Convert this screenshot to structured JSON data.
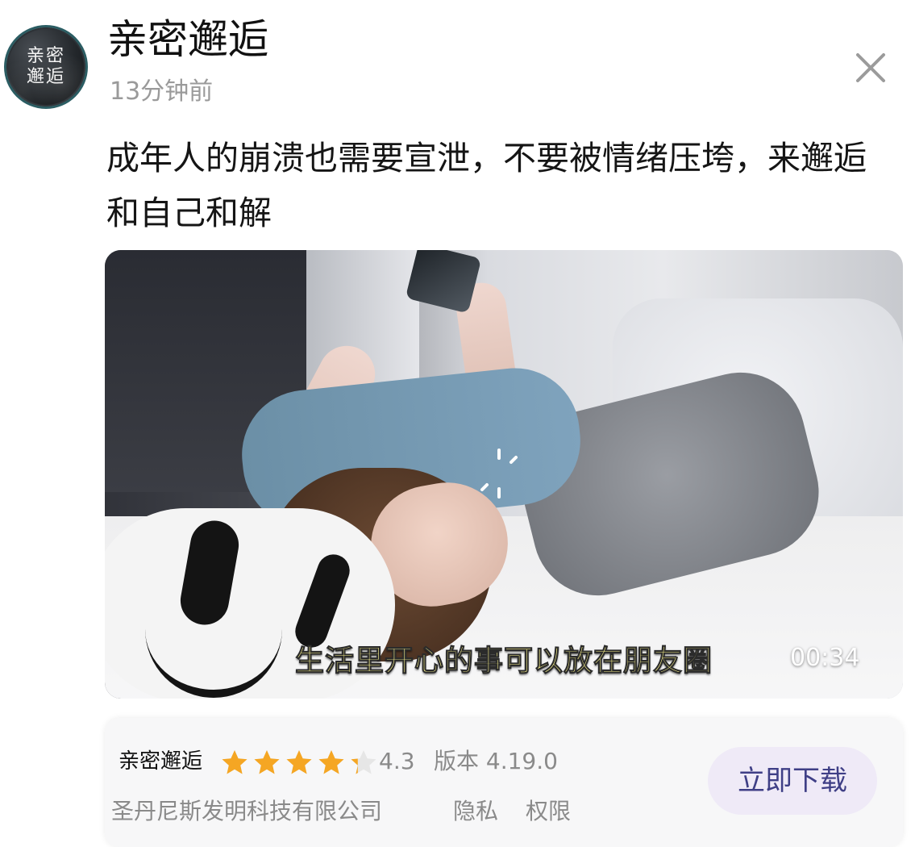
{
  "header": {
    "avatar_text": "亲密邂逅",
    "title": "亲密邂逅",
    "time": "13分钟前"
  },
  "post": {
    "text": "成年人的崩溃也需要宣泄，不要被情绪压垮，来邂逅和自己和解"
  },
  "video": {
    "subtitle": "生活里开心的事可以放在朋友圈",
    "duration": "00:34"
  },
  "app_card": {
    "name": "亲密邂逅",
    "rating": "4.3",
    "rating_value": 4.3,
    "version": "版本 4.19.0",
    "company": "圣丹尼斯发明科技有限公司",
    "privacy": "隐私",
    "permissions": "权限",
    "download_label": "立即下载"
  },
  "icons": {
    "close": "close-icon",
    "star": "star-icon",
    "spinner": "loading-spinner-icon"
  },
  "colors": {
    "star": "#f5a623",
    "download_bg": "#efeaf7",
    "download_text": "#3f3f86",
    "muted_text": "#8a8a8a"
  }
}
